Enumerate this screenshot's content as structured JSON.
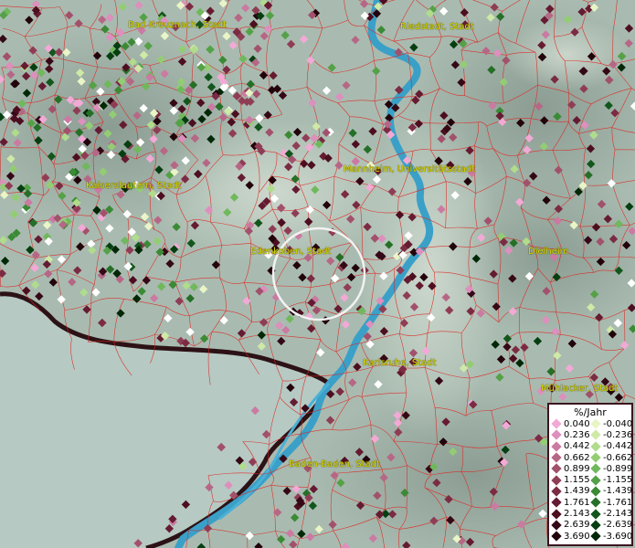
{
  "map": {
    "cities": [
      {
        "id": "bad-kreuznach",
        "label": "Bad Kreuznach, Stadt"
      },
      {
        "id": "riedstadt",
        "label": "Riedstadt, Stadt"
      },
      {
        "id": "mannheim",
        "label": "Mannheim, Universitätsstadt"
      },
      {
        "id": "kaiserslautern",
        "label": "Kaiserslautern, Stadt"
      },
      {
        "id": "edenkoben",
        "label": "Edenkoben, Stadt"
      },
      {
        "id": "dielheim",
        "label": "Dielheim"
      },
      {
        "id": "karlsruhe",
        "label": "Karlsruhe, Stadt"
      },
      {
        "id": "muehlacker",
        "label": "Mühlacker, Stadt"
      },
      {
        "id": "baden-baden",
        "label": "Baden-Baden, Stadt"
      }
    ],
    "colors": {
      "borders": "#e0231f",
      "river": "#3aa0c8",
      "terrain": "#a9bbb0",
      "pos": [
        "#f2a9d6",
        "#dd8fbd",
        "#cb7aa2",
        "#b76786",
        "#a2516c",
        "#8f3d55",
        "#7b2b42",
        "#651b31",
        "#4d0e20",
        "#350816",
        "#22030b"
      ],
      "neg": [
        "#e9f5c6",
        "#cfe9a6",
        "#b0dc8c",
        "#93cd73",
        "#70b85c",
        "#55a147",
        "#3b8a35",
        "#256f27",
        "#12561b",
        "#053e10",
        "#012806"
      ]
    }
  },
  "legend": {
    "title": "%/Jahr",
    "positive": [
      "0.040",
      "0.236",
      "0.442",
      "0.662",
      "0.899",
      "1.155",
      "1.439",
      "1.761",
      "2.143",
      "2.639",
      "3.690"
    ],
    "negative": [
      "-0.040",
      "-0.236",
      "-0.442",
      "-0.662",
      "-0.899",
      "-1.155",
      "-1.439",
      "-1.761",
      "-2.143",
      "-2.639",
      "-3.690"
    ]
  }
}
